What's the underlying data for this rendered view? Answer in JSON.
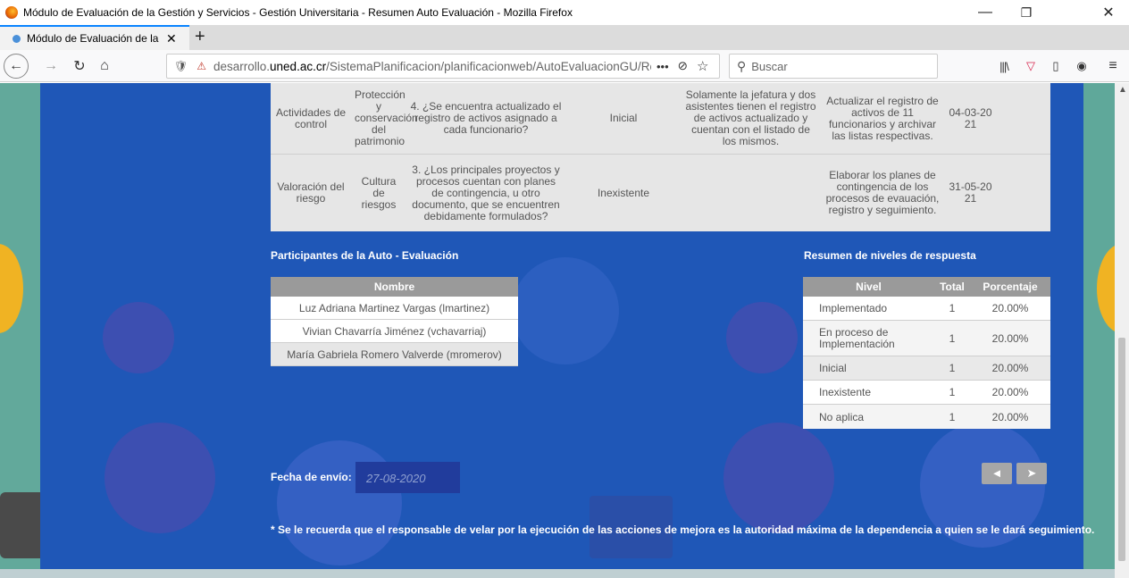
{
  "window": {
    "title": "Módulo de Evaluación de la Gestión y Servicios - Gestión Universitaria - Resumen Auto Evaluación - Mozilla Firefox",
    "minimize": "—",
    "maximize": "❐",
    "close": "✕"
  },
  "tab": {
    "label": "Módulo de Evaluación de la Ge",
    "close": "✕",
    "new_tab": "+"
  },
  "nav": {
    "back": "←",
    "forward": "→",
    "reload": "↻",
    "home": "⌂",
    "shield": "🛡",
    "insecure": "⚠",
    "url_prefix": "desarrollo.",
    "url_domain": "uned.ac.cr",
    "url_rest": "/SistemaPlanificacion/planificacionweb/AutoEvaluacionGU/Resume",
    "more": "•••",
    "pocket": "⊘",
    "bookmark": "☆",
    "search_placeholder": "Buscar",
    "library": "|||\\",
    "pocket2": "▽",
    "reader": "▯",
    "account": "◉",
    "menu": "≡"
  },
  "results_rows": [
    {
      "componente": "Actividades de control",
      "subcomponente": "Protección y conservación del patrimonio",
      "pregunta": "4. ¿Se encuentra actualizado el registro de activos asignado a cada funcionario?",
      "nivel": "Inicial",
      "observacion": "Solamente la jefatura y dos asistentes tienen el registro de activos actualizado y cuentan con el listado de los mismos.",
      "accion": "Actualizar el registro de activos de 11 funcionarios y archivar las listas respectivas.",
      "fecha": "04-03-2021"
    },
    {
      "componente": "Valoración del riesgo",
      "subcomponente": "Cultura de riesgos",
      "pregunta": "3. ¿Los principales proyectos y procesos cuentan con planes de contingencia, u otro documento, que se encuentren debidamente formulados?",
      "nivel": "Inexistente",
      "observacion": "",
      "accion": "Elaborar los planes de contingencia de los procesos de evauación, registro y seguimiento.",
      "fecha": "31-05-2021"
    }
  ],
  "participants": {
    "title": "Participantes de la Auto - Evaluación",
    "header": "Nombre",
    "rows": [
      "Luz Adriana Martinez Vargas (lmartinez)",
      "Vivian Chavarría Jiménez (vchavarriaj)",
      "María Gabriela Romero Valverde (mromerov)"
    ]
  },
  "levels": {
    "title": "Resumen de niveles de respuesta",
    "headers": [
      "Nivel",
      "Total",
      "Porcentaje"
    ],
    "rows": [
      {
        "nivel": "Implementado",
        "total": "1",
        "porcentaje": "20.00%"
      },
      {
        "nivel": "En proceso de Implementación",
        "total": "1",
        "porcentaje": "20.00%"
      },
      {
        "nivel": "Inicial",
        "total": "1",
        "porcentaje": "20.00%"
      },
      {
        "nivel": "Inexistente",
        "total": "1",
        "porcentaje": "20.00%"
      },
      {
        "nivel": "No aplica",
        "total": "1",
        "porcentaje": "20.00%"
      }
    ]
  },
  "submission": {
    "label": "Fecha de envío:",
    "date": "27-08-2020",
    "back_icon": "◄",
    "send_icon": "➤"
  },
  "note": "* Se le recuerda que el responsable de velar por la ejecución de las acciones de mejora es la autoridad máxima de la dependencia a quien se le dará seguimiento."
}
